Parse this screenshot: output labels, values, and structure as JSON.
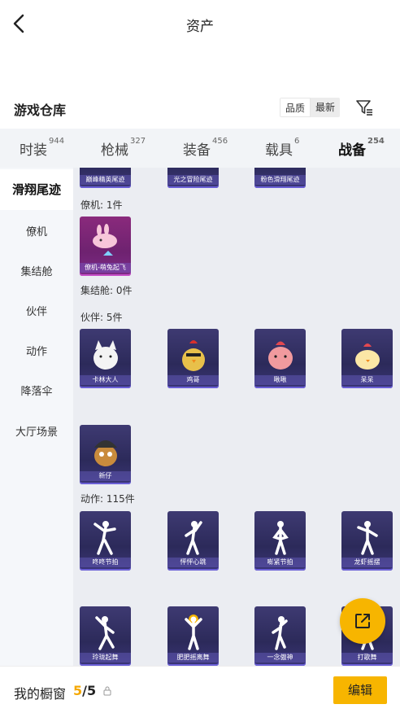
{
  "header": {
    "title": "资产"
  },
  "warehouse": {
    "title": "游戏仓库",
    "sort_quality": "品质",
    "sort_newest": "最新"
  },
  "tabs": [
    {
      "label": "时装",
      "count": "944"
    },
    {
      "label": "枪械",
      "count": "327"
    },
    {
      "label": "装备",
      "count": "456"
    },
    {
      "label": "载具",
      "count": "6"
    },
    {
      "label": "战备",
      "count": "254"
    }
  ],
  "sidebar": [
    {
      "label": "滑翔尾迹"
    },
    {
      "label": "僚机"
    },
    {
      "label": "集结舱"
    },
    {
      "label": "伙伴"
    },
    {
      "label": "动作"
    },
    {
      "label": "降落伞"
    },
    {
      "label": "大厅场景"
    }
  ],
  "content": {
    "trails": [
      "巅峰精英尾迹",
      "光之冒险尾迹",
      "粉色滑翔尾迹"
    ],
    "wingman_label": "僚机: 1件",
    "wingman_items": [
      "僚机-萌兔起飞"
    ],
    "pod_label": "集结舱: 0件",
    "partner_label": "伙伴: 5件",
    "partner_items": [
      "卡林大人",
      "鸡哥",
      "啾啾",
      "呆呆",
      "新仔"
    ],
    "action_label": "动作: 115件",
    "action_items": [
      "咚咚节拍",
      "怦怦心跳",
      "嘭紧节拍",
      "龙虾摇摆",
      "玲珑起舞",
      "肥肥摇离舞",
      "一念傲神",
      "打歌舞"
    ]
  },
  "cabinet": {
    "label": "我的橱窗",
    "current": "5",
    "total": "/5"
  },
  "edit_button": "编辑",
  "colors": {
    "accent": "#f7b500",
    "card": "#2c2a5a",
    "card_pink": "#6e2270"
  }
}
